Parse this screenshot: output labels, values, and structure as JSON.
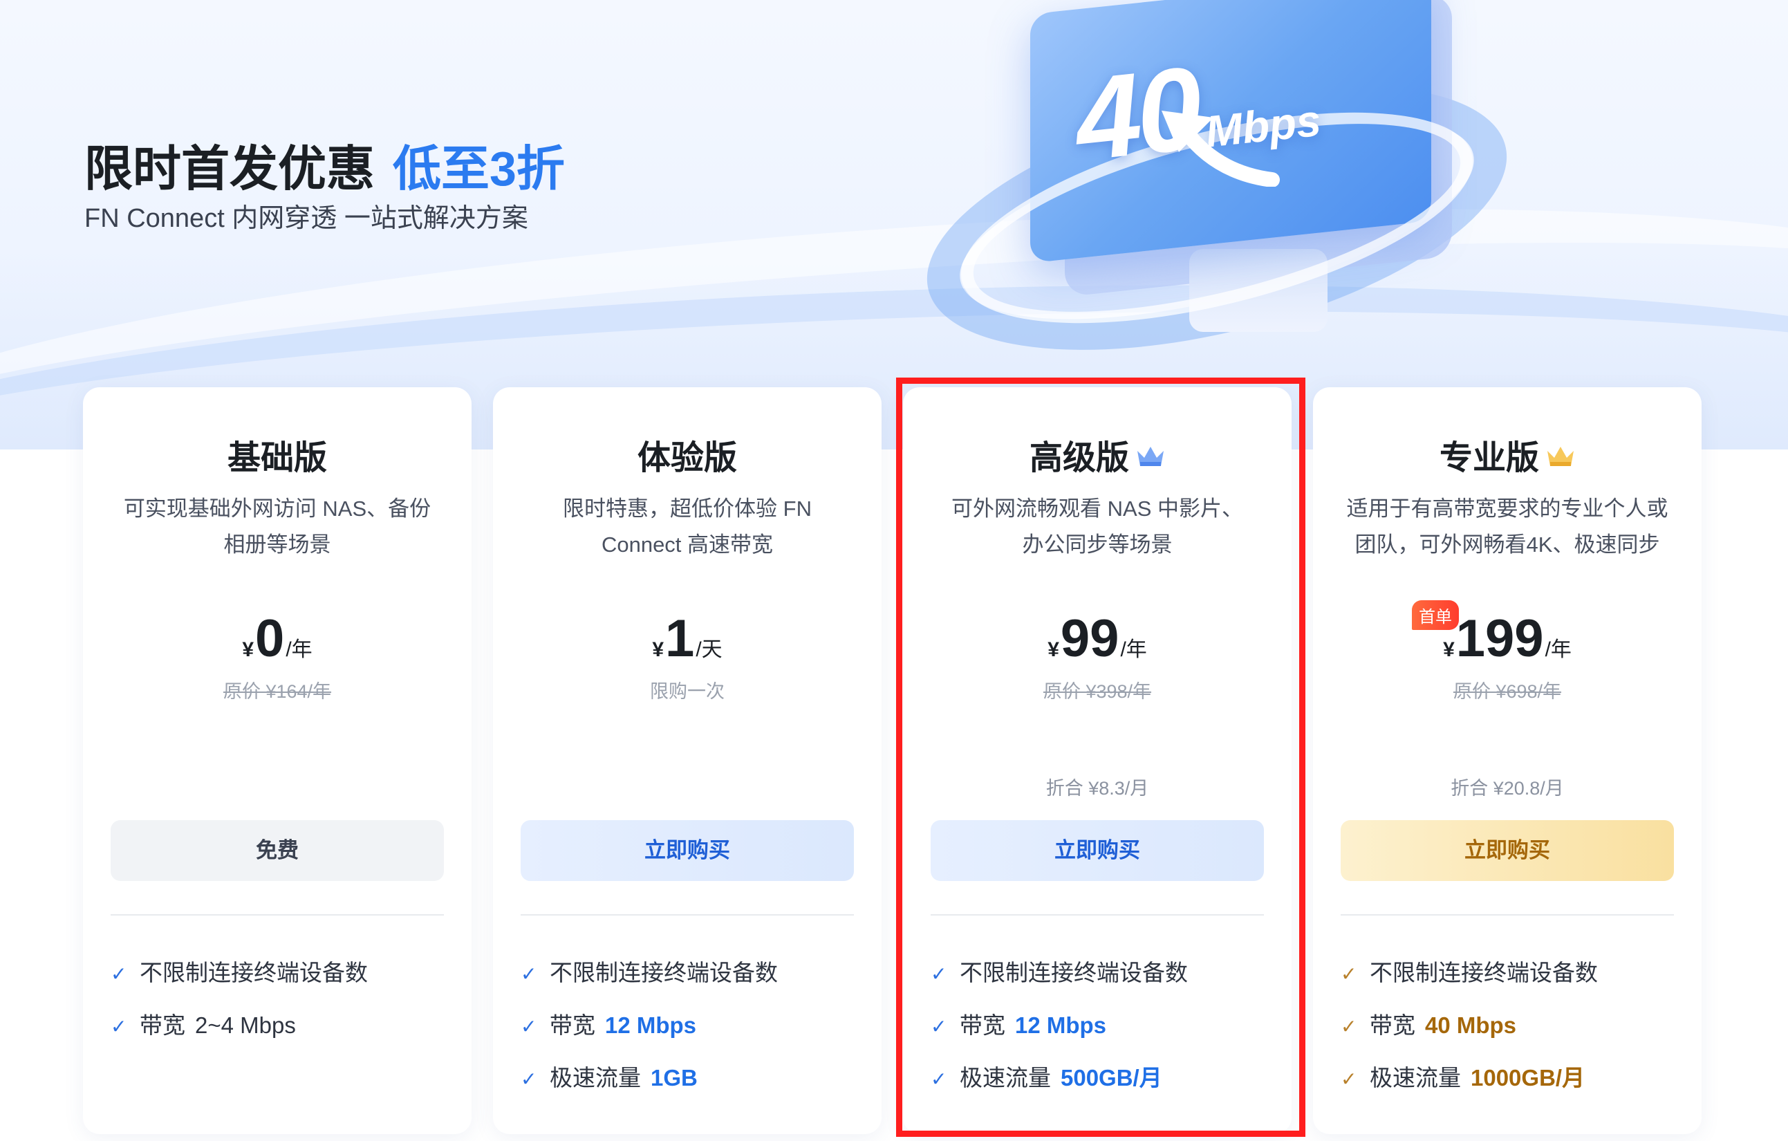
{
  "header": {
    "title": "限时首发优惠",
    "title_accent": "低至3折",
    "subtitle": "FN Connect 内网穿透 一站式解决方案"
  },
  "illustration": {
    "speed_number": "40",
    "speed_unit": "Mbps"
  },
  "plans": [
    {
      "name": "基础版",
      "crown": "",
      "desc_line1": "可实现基础外网访问 NAS、备份",
      "desc_line2": "相册等场景",
      "currency": "¥",
      "price": "0",
      "period": "/年",
      "badge": "",
      "original": "原价 ¥164/年",
      "monthly": "",
      "button": "免费",
      "features": [
        {
          "label": "不限制连接终端设备数",
          "value": ""
        },
        {
          "label": "带宽",
          "value": "2~4 Mbps"
        }
      ]
    },
    {
      "name": "体验版",
      "crown": "",
      "desc_line1": "限时特惠，超低价体验 FN",
      "desc_line2": "Connect 高速带宽",
      "currency": "¥",
      "price": "1",
      "period": "/天",
      "badge": "",
      "original": "限购一次",
      "monthly": "",
      "button": "立即购买",
      "features": [
        {
          "label": "不限制连接终端设备数",
          "value": ""
        },
        {
          "label": "带宽",
          "value": "12 Mbps"
        },
        {
          "label": "极速流量",
          "value": "1GB"
        }
      ]
    },
    {
      "name": "高级版",
      "crown": "blue-crown-icon",
      "desc_line1": "可外网流畅观看 NAS 中影片、",
      "desc_line2": "办公同步等场景",
      "currency": "¥",
      "price": "99",
      "period": "/年",
      "badge": "",
      "original": "原价 ¥398/年",
      "monthly": "折合 ¥8.3/月",
      "button": "立即购买",
      "features": [
        {
          "label": "不限制连接终端设备数",
          "value": ""
        },
        {
          "label": "带宽",
          "value": "12 Mbps"
        },
        {
          "label": "极速流量",
          "value": "500GB/月"
        }
      ]
    },
    {
      "name": "专业版",
      "crown": "gold-crown-icon",
      "desc_line1": "适用于有高带宽要求的专业个人或",
      "desc_line2": "团队，可外网畅看4K、极速同步",
      "currency": "¥",
      "price": "199",
      "period": "/年",
      "badge": "首单",
      "original": "原价 ¥698/年",
      "monthly": "折合 ¥20.8/月",
      "button": "立即购买",
      "features": [
        {
          "label": "不限制连接终端设备数",
          "value": ""
        },
        {
          "label": "带宽",
          "value": "40 Mbps"
        },
        {
          "label": "极速流量",
          "value": "1000GB/月"
        }
      ]
    }
  ],
  "colors": {
    "accent_blue": "#2b7bf0",
    "gold": "#a5670a",
    "highlight_border": "#ff1e1e"
  },
  "icons": {
    "check": "check-icon"
  }
}
